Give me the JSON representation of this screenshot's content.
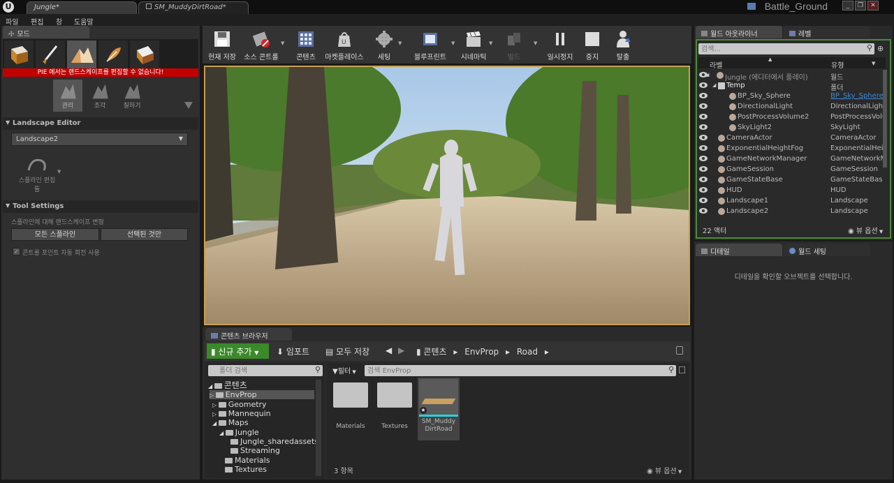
{
  "window": {
    "tabs": [
      "Jungle*",
      "SM_MuddyDirtRoad*"
    ],
    "project": "Battle_Ground",
    "controls": [
      "_",
      "❐",
      "✕"
    ]
  },
  "menu": [
    "파일",
    "편집",
    "창",
    "도움말"
  ],
  "modes": {
    "tab": "모드",
    "warning": "PIE 에서는 랜드스케이프를 편집할 수 없습니다!",
    "subtools": [
      "관리",
      "조각",
      "칠하기"
    ],
    "landscape_editor_title": "Landscape Editor",
    "landscape_select": "Landscape2",
    "spline_tool": "스플라인 편집",
    "spline_tool_sub": "툴",
    "tool_settings_title": "Tool Settings",
    "spline_desc": "스플라인에 대해 랜드스케이프 변형",
    "btn_all_splines": "모든 스플라인",
    "btn_selected_only": "선택된 것만",
    "auto_rotate_label": "콘트롤 포인트 자동 회전 사용"
  },
  "toolbar": {
    "buttons": [
      {
        "label": "현재 저장",
        "icon": "save-icon"
      },
      {
        "label": "소스 콘트롤",
        "icon": "source-control-icon"
      },
      {
        "label": "콘텐츠",
        "icon": "content-icon"
      },
      {
        "label": "마켓플레이스",
        "icon": "marketplace-icon"
      },
      {
        "label": "세팅",
        "icon": "settings-icon"
      },
      {
        "label": "블루프린트",
        "icon": "blueprint-icon"
      },
      {
        "label": "시네마틱",
        "icon": "cinematics-icon"
      },
      {
        "label": "빌드",
        "icon": "build-icon"
      },
      {
        "label": "일시정지",
        "icon": "pause-icon"
      },
      {
        "label": "중지",
        "icon": "stop-icon"
      },
      {
        "label": "탈출",
        "icon": "eject-icon"
      }
    ]
  },
  "outliner": {
    "tab": "월드 아웃라이너",
    "tab2": "레벨",
    "search_placeholder": "검색...",
    "col_label": "라벨",
    "col_type": "유형",
    "rows": [
      {
        "label": "Jungle (에디터에서 플레이)",
        "type": "월드",
        "indent": 0
      },
      {
        "label": "Temp",
        "type": "폴더",
        "indent": 1
      },
      {
        "label": "BP_Sky_Sphere",
        "type": "BP_Sky_Sphere",
        "indent": 2
      },
      {
        "label": "DirectionalLight",
        "type": "DirectionalLight",
        "indent": 2
      },
      {
        "label": "PostProcessVolume2",
        "type": "PostProcessVolume",
        "indent": 2
      },
      {
        "label": "SkyLight2",
        "type": "SkyLight",
        "indent": 2
      },
      {
        "label": "CameraActor",
        "type": "CameraActor",
        "indent": 1
      },
      {
        "label": "ExponentialHeightFog",
        "type": "ExponentialHeightFog",
        "indent": 1
      },
      {
        "label": "GameNetworkManager",
        "type": "GameNetworkManager",
        "indent": 1
      },
      {
        "label": "GameSession",
        "type": "GameSession",
        "indent": 1
      },
      {
        "label": "GameStateBase",
        "type": "GameStateBase",
        "indent": 1
      },
      {
        "label": "HUD",
        "type": "HUD",
        "indent": 1
      },
      {
        "label": "Landscape1",
        "type": "Landscape",
        "indent": 1
      },
      {
        "label": "Landscape2",
        "type": "Landscape",
        "indent": 1
      }
    ],
    "actor_count": "22 액터",
    "view_options": "뷰 옵션"
  },
  "details": {
    "tab": "디테일",
    "tab2": "월드 세팅",
    "empty_message": "디테일을 확인할 오브젝트를 선택합니다."
  },
  "content_browser": {
    "tab": "콘텐츠 브라우저",
    "add_new": "신규 추가",
    "import": "임포트",
    "save_all": "모두 저장",
    "path": [
      "콘텐츠",
      "EnvProp",
      "Road"
    ],
    "folder_search_placeholder": "폴더 검색",
    "filters": "필터",
    "asset_search_placeholder": "검색 EnvProp",
    "tree": [
      {
        "label": "콘텐츠",
        "level": 0
      },
      {
        "label": "EnvProp",
        "level": 1
      },
      {
        "label": "Geometry",
        "level": 1
      },
      {
        "label": "Mannequin",
        "level": 1
      },
      {
        "label": "Maps",
        "level": 1
      },
      {
        "label": "Jungle",
        "level": 2
      },
      {
        "label": "Jungle_sharedassets",
        "level": 3
      },
      {
        "label": "Streaming",
        "level": 3
      },
      {
        "label": "Materials",
        "level": 2
      },
      {
        "label": "Textures",
        "level": 2
      }
    ],
    "assets": [
      "Materials",
      "Textures",
      "SM_Muddy DirtRoad"
    ],
    "item_count": "3 항목",
    "view_options": "뷰 옵션"
  }
}
